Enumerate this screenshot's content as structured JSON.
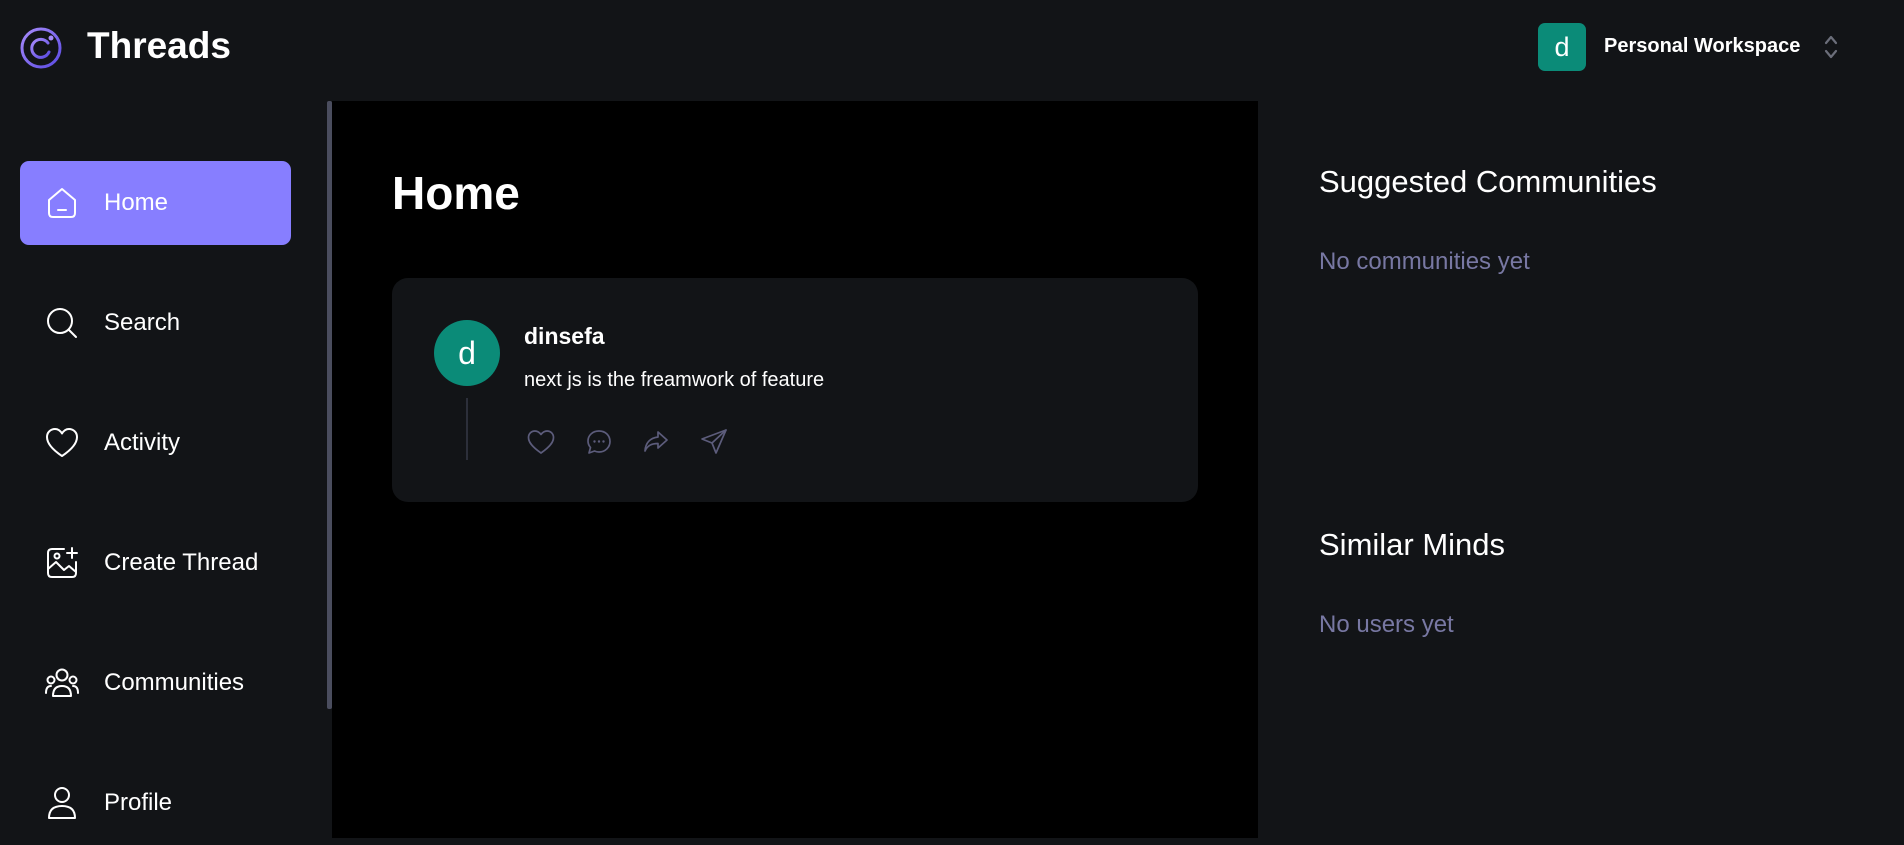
{
  "app": {
    "title": "Threads"
  },
  "workspace": {
    "avatar_letter": "d",
    "label": "Personal Workspace",
    "avatar_color": "#0b8b78"
  },
  "sidebar": {
    "items": [
      {
        "label": "Home",
        "icon": "home-icon",
        "active": true
      },
      {
        "label": "Search",
        "icon": "search-icon",
        "active": false
      },
      {
        "label": "Activity",
        "icon": "heart-icon",
        "active": false
      },
      {
        "label": "Create Thread",
        "icon": "create-image-icon",
        "active": false
      },
      {
        "label": "Communities",
        "icon": "users-icon",
        "active": false
      },
      {
        "label": "Profile",
        "icon": "user-icon",
        "active": false
      }
    ]
  },
  "main": {
    "title": "Home",
    "posts": [
      {
        "avatar_letter": "d",
        "author": "dinsefa",
        "text": "next js is the freamwork of feature",
        "actions": [
          "heart-icon",
          "reply-icon",
          "repost-icon",
          "share-icon"
        ]
      }
    ]
  },
  "rightbar": {
    "suggested_title": "Suggested Communities",
    "suggested_empty": "No communities yet",
    "similar_title": "Similar Minds",
    "similar_empty": "No users yet"
  },
  "colors": {
    "accent": "#877eff",
    "background": "#000000",
    "panel": "#121417",
    "muted": "#7878a3",
    "avatar": "#0b8b78"
  }
}
